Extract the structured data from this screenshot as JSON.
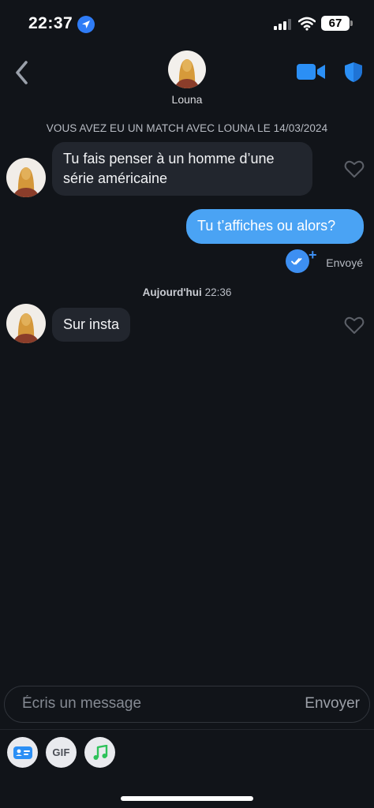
{
  "status_bar": {
    "time": "22:37",
    "battery": "67"
  },
  "header": {
    "contact_name": "Louna",
    "back_icon": "chevron-left-icon",
    "video_icon": "video-camera-icon",
    "safety_icon": "shield-icon"
  },
  "chat": {
    "match_banner": "VOUS AVEZ EU UN MATCH AVEC LOUNA LE 14/03/2024",
    "messages": [
      {
        "direction": "in",
        "text": "Tu fais penser à un homme d’une série américaine"
      },
      {
        "direction": "out",
        "text": "Tu t’affiches ou alors?",
        "status": "Envoyé"
      },
      {
        "direction": "in",
        "text": "Sur insta"
      }
    ],
    "day_separator": {
      "day": "Aujourd'hui",
      "time": "22:36"
    }
  },
  "composer": {
    "placeholder": "Écris un message",
    "send_label": "Envoyer"
  },
  "tools": {
    "gif_label": "GIF",
    "icons": [
      "contact-card-icon",
      "gif-icon",
      "music-note-icon"
    ]
  },
  "colors": {
    "background": "#111419",
    "incoming_bubble": "#22262e",
    "outgoing_bubble": "#4aa3f4",
    "accent": "#2f7cf6"
  }
}
